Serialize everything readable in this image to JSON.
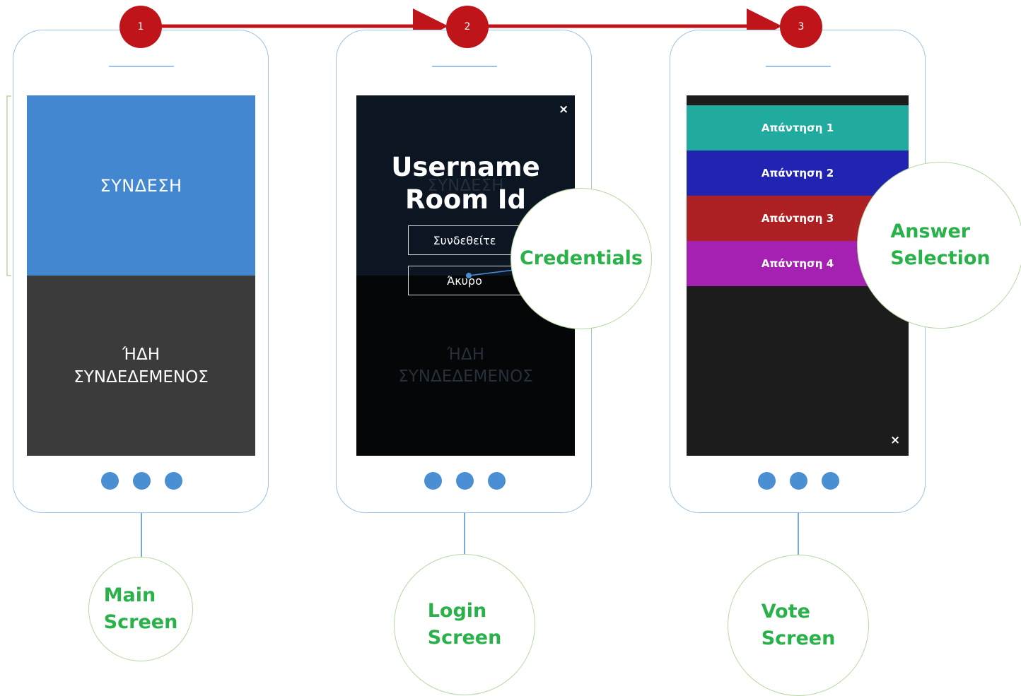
{
  "steps": [
    {
      "number": "1"
    },
    {
      "number": "2"
    },
    {
      "number": "3"
    }
  ],
  "main_screen": {
    "top_button": "ΣΥΝΔΕΣΗ",
    "bottom_button_line1": "ΉΔΗ",
    "bottom_button_line2": "ΣΥΝΔΕΔΕΜΕΝΟΣ"
  },
  "login_screen": {
    "close": "×",
    "field_username": "Username",
    "field_room": "Room Id",
    "ghost_top": "ΣΥΝΔΕΣΗ",
    "ghost_bottom_line1": "ΉΔΗ",
    "ghost_bottom_line2": "ΣΥΝΔΕΔΕΜΕΝΟΣ",
    "connect_button": "Συνδεθείτε",
    "cancel_button": "Άκυρο"
  },
  "vote_screen": {
    "answers": [
      {
        "label": "Απάντηση 1",
        "color": "#21ab9f"
      },
      {
        "label": "Απάντηση 2",
        "color": "#2124b1"
      },
      {
        "label": "Απάντηση 3",
        "color": "#ad2124"
      },
      {
        "label": "Απάντηση 4",
        "color": "#a421b1"
      }
    ],
    "close": "×"
  },
  "callouts": {
    "main": {
      "line1": "Main",
      "line2": "Screen"
    },
    "login": {
      "line1": "Login",
      "line2": "Screen"
    },
    "vote": {
      "line1": "Vote",
      "line2": "Screen"
    },
    "credentials": {
      "line1": "Credentials"
    },
    "answer": {
      "line1": "Answer",
      "line2": "Selection"
    }
  },
  "colors": {
    "step_red": "#c0141b",
    "frame_blue": "#9cc3e6",
    "callout_green": "#2ab24a",
    "dot_blue": "#4a8fd4"
  }
}
